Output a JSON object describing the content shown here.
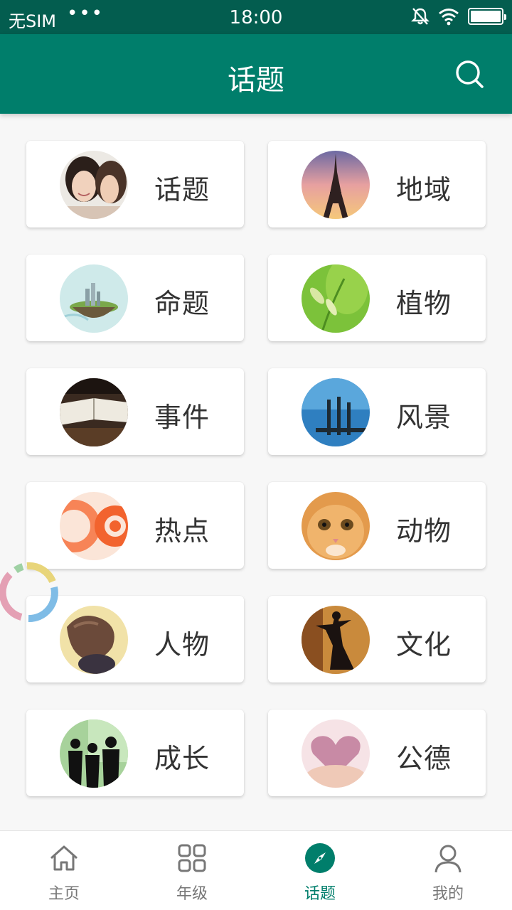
{
  "status_bar": {
    "carrier": "无SIM",
    "dots": "•••",
    "time": "18:00"
  },
  "app_bar": {
    "title": "话题",
    "search_icon": "search-icon"
  },
  "colors": {
    "status_bar": "#035d4f",
    "primary": "#007e6b",
    "card_bg": "#ffffff",
    "nav_inactive": "#777777"
  },
  "topics": [
    {
      "label": "话题",
      "icon": "two-women-photo"
    },
    {
      "label": "地域",
      "icon": "eiffel-tower-photo"
    },
    {
      "label": "命题",
      "icon": "floating-island-photo"
    },
    {
      "label": "植物",
      "icon": "grass-photo"
    },
    {
      "label": "事件",
      "icon": "open-book-photo"
    },
    {
      "label": "风景",
      "icon": "pier-sea-photo"
    },
    {
      "label": "热点",
      "icon": "orange-rings-photo"
    },
    {
      "label": "动物",
      "icon": "kitten-photo"
    },
    {
      "label": "人物",
      "icon": "girl-hair-photo"
    },
    {
      "label": "文化",
      "icon": "dancer-silhouette-photo"
    },
    {
      "label": "成长",
      "icon": "people-silhouette-photo"
    },
    {
      "label": "公德",
      "icon": "heart-hands-photo"
    }
  ],
  "bottom_nav": [
    {
      "label": "主页",
      "icon": "home-icon",
      "active": false
    },
    {
      "label": "年级",
      "icon": "grid-icon",
      "active": false
    },
    {
      "label": "话题",
      "icon": "compass-icon",
      "active": true
    },
    {
      "label": "我的",
      "icon": "person-icon",
      "active": false
    }
  ]
}
